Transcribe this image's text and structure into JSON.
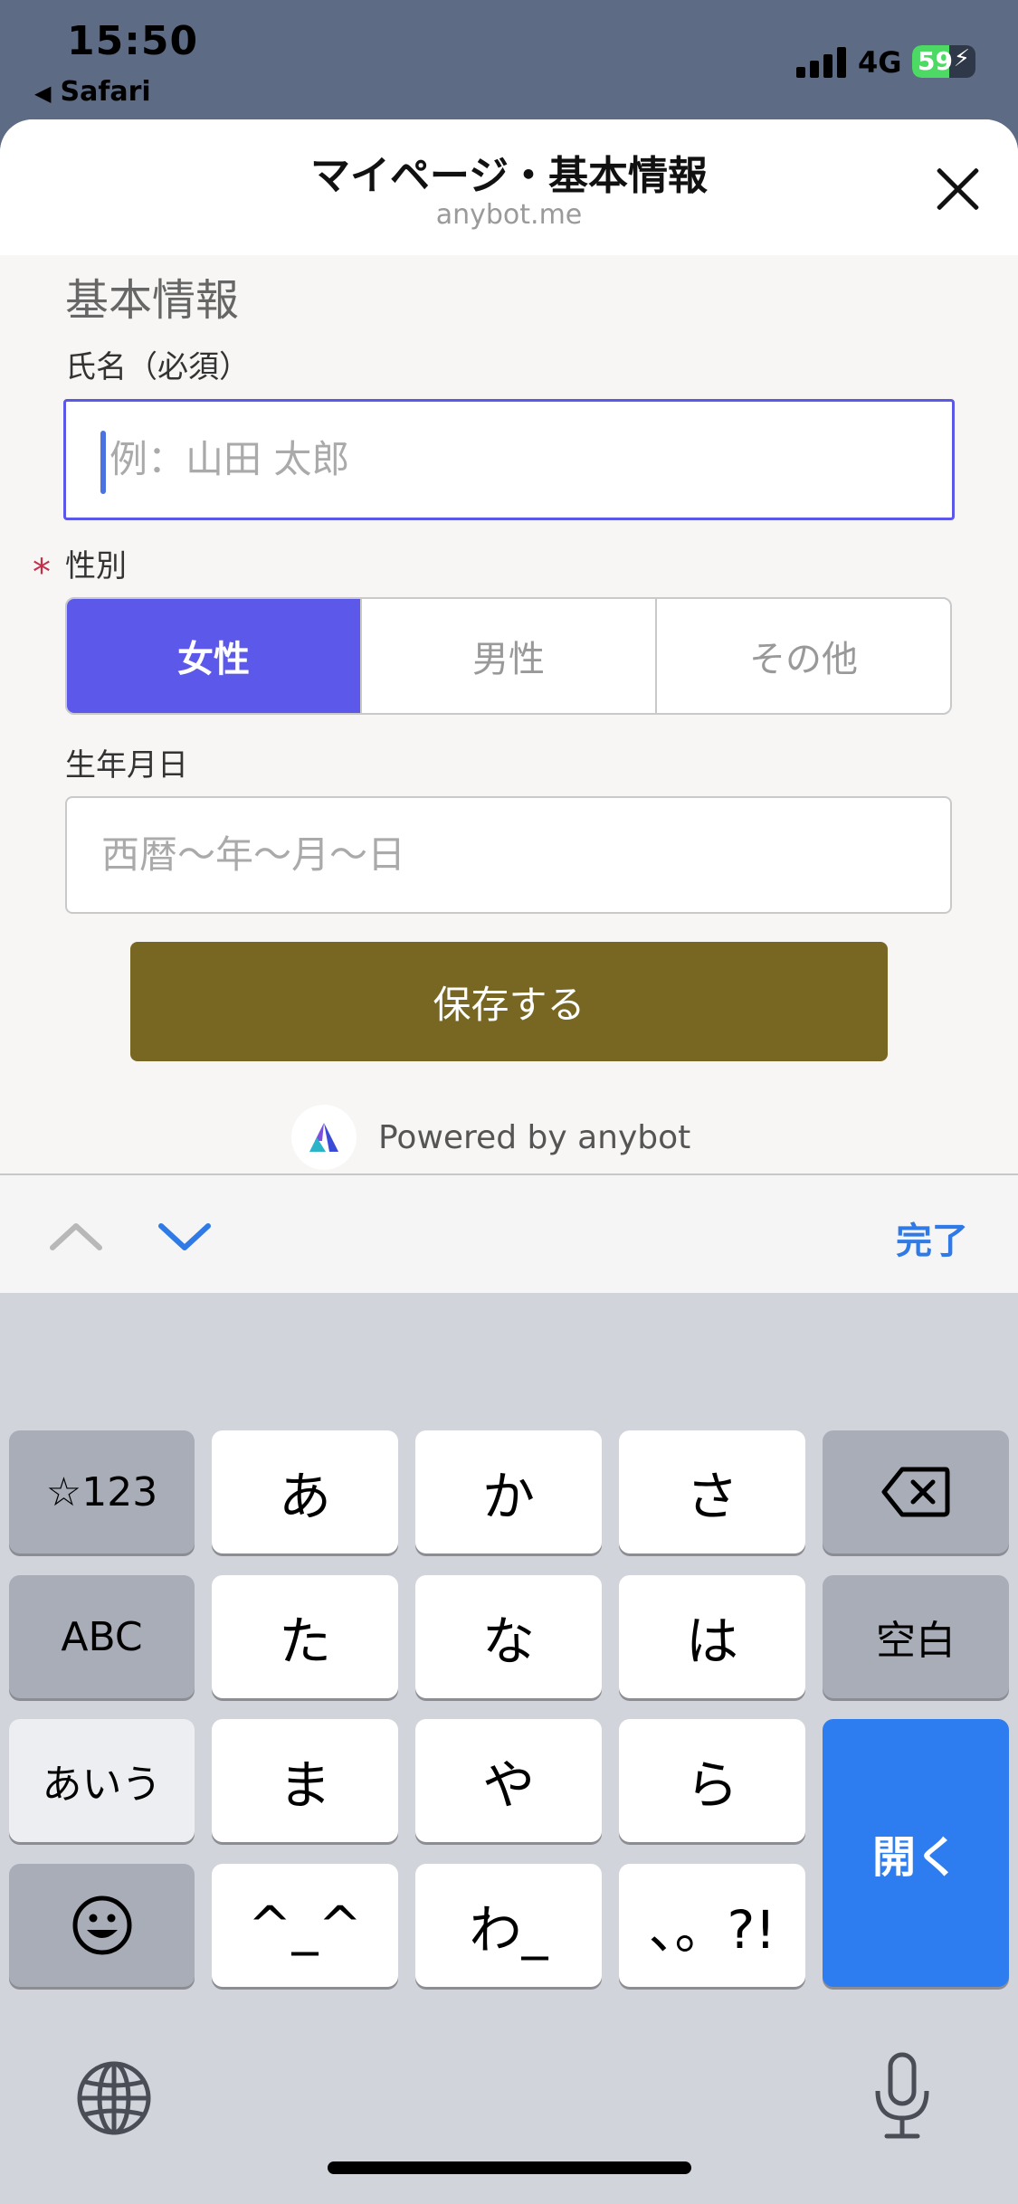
{
  "status_bar": {
    "time": "15:50",
    "back_app": "Safari",
    "network": "4G",
    "battery_level": "59",
    "battery_fraction": 0.59,
    "battery_color": "#4cd964"
  },
  "sheet": {
    "title": "マイページ・基本情報",
    "domain": "anybot.me",
    "close_icon": "close-icon"
  },
  "form": {
    "section_title": "基本情報",
    "name_label": "氏名（必須）",
    "name_placeholder": "例：山田 太郎",
    "gender_label": "性別",
    "gender_required_mark": "*",
    "gender_options": [
      "女性",
      "男性",
      "その他"
    ],
    "gender_selected": "女性",
    "dob_label": "生年月日",
    "dob_placeholder": "西暦〜年〜月〜日",
    "save_label": "保存する",
    "powered_by": "Powered by anybot",
    "accent_color": "#5c58ea",
    "save_color": "#786623"
  },
  "accessory": {
    "done_label": "完了"
  },
  "keyboard": {
    "row1": [
      "☆123",
      "あ",
      "か",
      "さ",
      "delete"
    ],
    "row2": [
      "ABC",
      "た",
      "な",
      "は",
      "空白"
    ],
    "row3": [
      "あいう",
      "ま",
      "や",
      "ら"
    ],
    "row4": [
      "emoji",
      "^_^",
      "わ_",
      "、。?!"
    ],
    "return_label": "開く",
    "return_color": "#2d7df0"
  }
}
